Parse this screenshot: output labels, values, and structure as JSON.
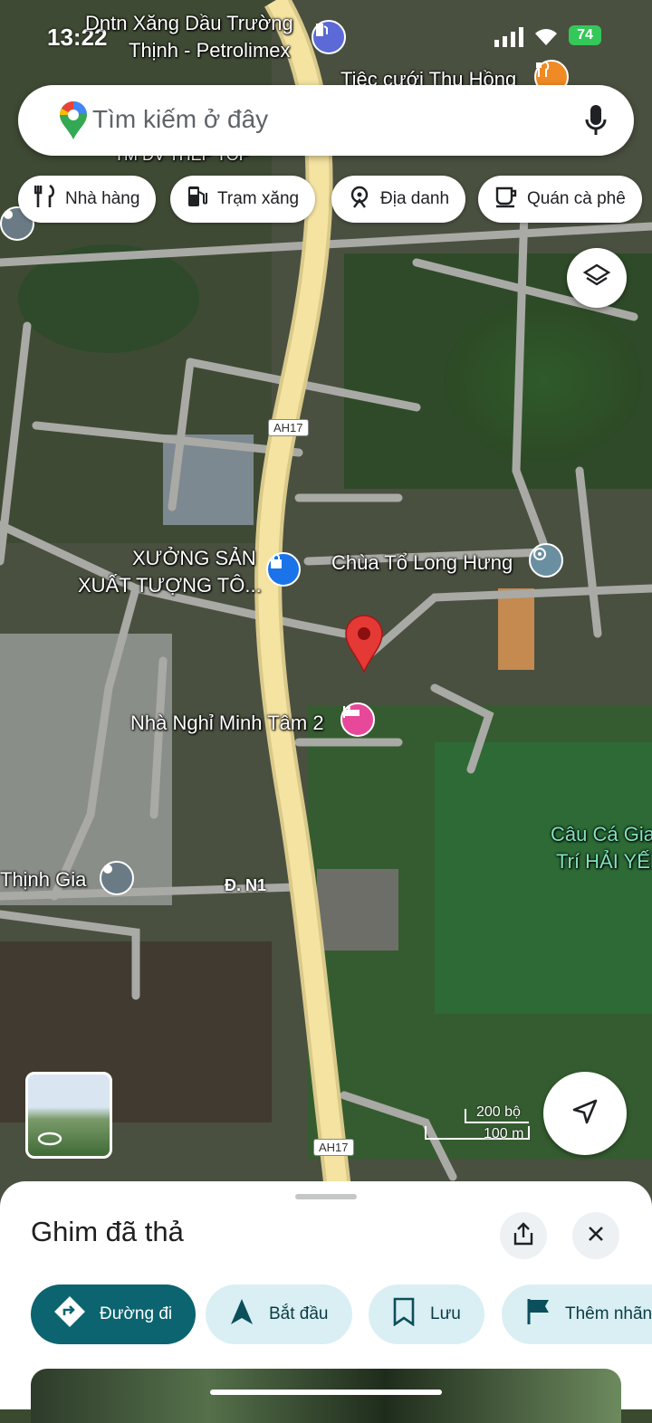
{
  "status_bar": {
    "time": "13:22",
    "battery": "74"
  },
  "search": {
    "placeholder": "Tìm kiếm ở đây"
  },
  "chips": [
    {
      "label": "Nhà hàng",
      "icon": "restaurant-icon"
    },
    {
      "label": "Trạm xăng",
      "icon": "gas-station-icon"
    },
    {
      "label": "Địa danh",
      "icon": "landmark-icon"
    },
    {
      "label": "Quán cà phê",
      "icon": "coffee-icon"
    }
  ],
  "map": {
    "labels": {
      "petrolimex_1": "Dntn Xăng Dầu Trường",
      "petrolimex_2": "Thịnh - Petrolimex",
      "tiec_cuoi": "Tiệc cưới Thu Hồng",
      "partial_top": "TM DV THEP TOP",
      "xuong_1": "XƯỞNG SẢN",
      "xuong_2": "XUẤT TƯỢNG TÔ...",
      "chua": "Chùa Tổ Long Hưng",
      "nha_nghi": "Nhà Nghỉ Minh Tâm 2",
      "thinh_gia": "Thịnh Gia",
      "cau_ca_1": "Câu Cá Gia",
      "cau_ca_2": "Trí HẢI YẾN"
    },
    "road_shield_top": "AH17",
    "road_shield_bottom": "AH17",
    "road_n1": "Đ. N1",
    "scale_ft": "200 bộ",
    "scale_m": "100 m",
    "colors": {
      "road_major": "#f4e3a1",
      "road_minor": "#a9aaa5",
      "pin": "#e53935",
      "accent": "#0b6470"
    }
  },
  "sheet": {
    "title": "Ghim đã thả",
    "actions": [
      {
        "label": "Đường đi",
        "icon": "directions-icon"
      },
      {
        "label": "Bắt đầu",
        "icon": "navigation-arrow-icon"
      },
      {
        "label": "Lưu",
        "icon": "bookmark-icon"
      },
      {
        "label": "Thêm nhãn",
        "icon": "flag-icon"
      }
    ]
  }
}
